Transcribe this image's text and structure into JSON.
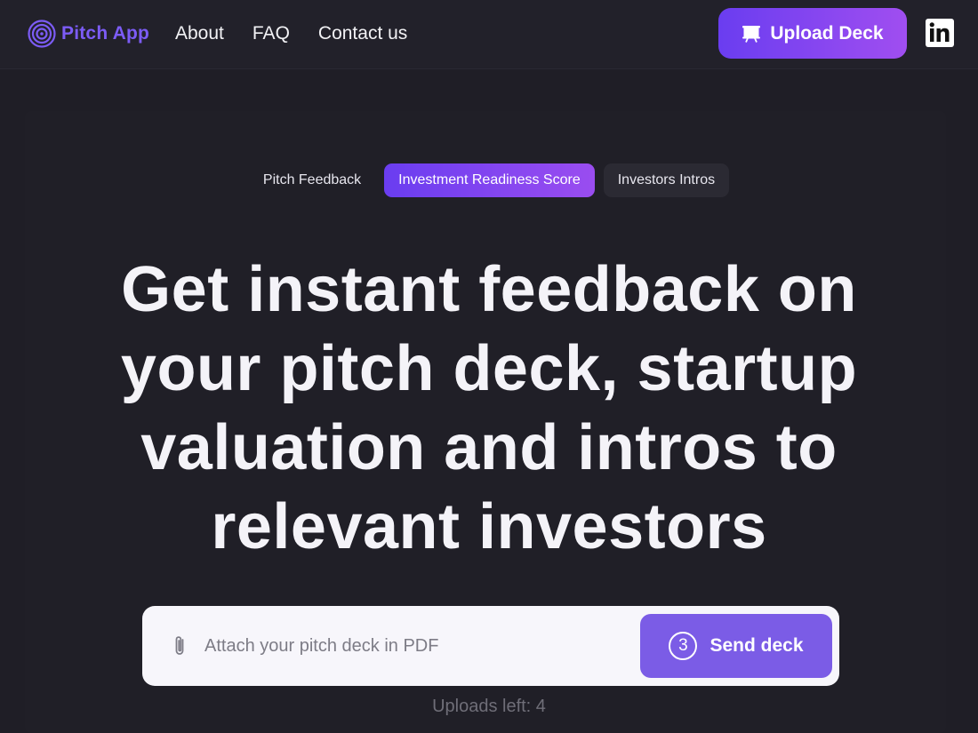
{
  "header": {
    "logo_text": "Pitch App",
    "nav": [
      {
        "label": "About"
      },
      {
        "label": "FAQ"
      },
      {
        "label": "Contact us"
      }
    ],
    "upload_button": "Upload Deck",
    "social_icon": "linkedin-icon"
  },
  "tabs": [
    {
      "label": "Pitch Feedback",
      "active": false
    },
    {
      "label": "Investment Readiness Score",
      "active": true
    },
    {
      "label": "Investors Intros",
      "active": false
    }
  ],
  "hero": {
    "headline_lines": [
      "Get instant feedback on",
      "your pitch deck, startup",
      "valuation and intros to",
      "relevant investors"
    ]
  },
  "upload": {
    "placeholder": "Attach your pitch deck in PDF",
    "send_count": "3",
    "send_label": "Send deck",
    "uploads_left": "Uploads left: 4"
  },
  "colors": {
    "accent": "#7c5cf6",
    "background": "#1f1e26",
    "button_gradient_start": "#6a3df0",
    "button_gradient_end": "#a04ef0"
  }
}
